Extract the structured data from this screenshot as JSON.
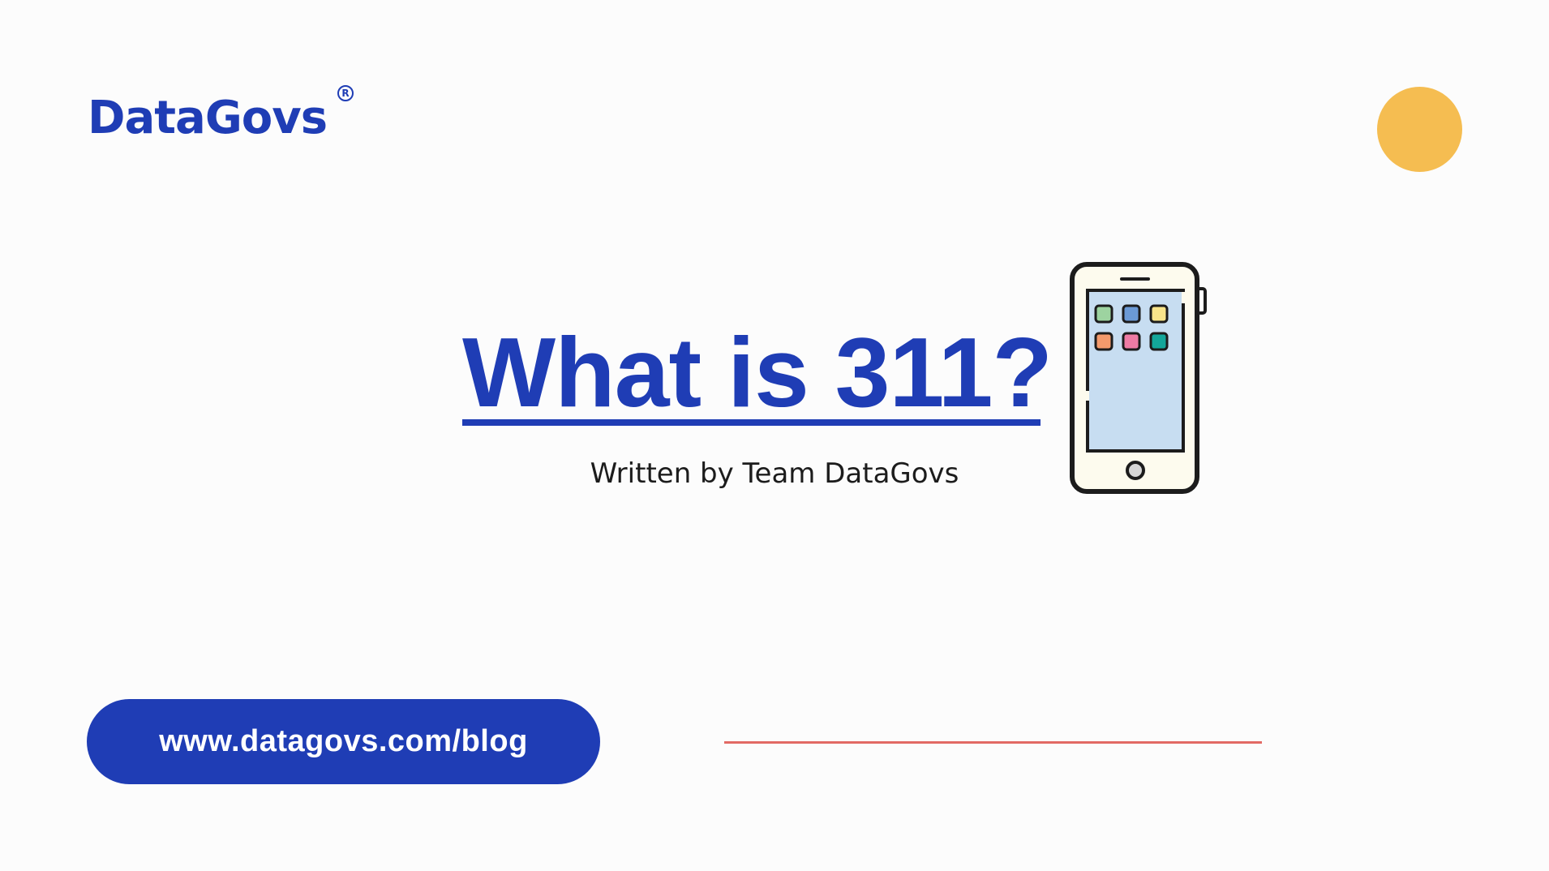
{
  "brand": {
    "name": "DataGovs",
    "registered_mark": "R",
    "color": "#1f3db5"
  },
  "hero": {
    "title": "What is 311?",
    "byline": "Written by Team DataGovs",
    "illustration_icon": "smartphone-icon"
  },
  "footer": {
    "url": "www.datagovs.com/blog"
  },
  "colors": {
    "brand_blue": "#1f3db5",
    "accent_yellow": "#f5bd51",
    "divider_red": "#e26a64",
    "background": "#fcfcfc"
  }
}
